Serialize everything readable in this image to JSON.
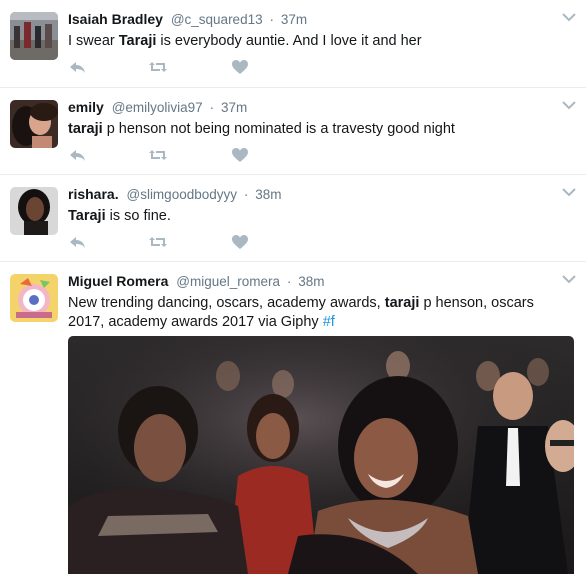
{
  "tweets": [
    {
      "name": "Isaiah Bradley",
      "handle": "@c_squared13",
      "separator": "·",
      "time": "37m",
      "text_parts": [
        "I swear ",
        "Taraji",
        " is everybody auntie. And I love it and her"
      ]
    },
    {
      "name": "emily",
      "handle": "@emilyolivia97",
      "separator": "·",
      "time": "37m",
      "text_parts": [
        "taraji",
        " p henson not being nominated is a travesty good night"
      ]
    },
    {
      "name": "rishara.",
      "handle": "@slimgoodbodyyy",
      "separator": "·",
      "time": "38m",
      "text_parts": [
        "Taraji",
        " is so fine."
      ]
    },
    {
      "name": "Miguel Romera",
      "handle": "@miguel_romera",
      "separator": "·",
      "time": "38m",
      "text_parts": [
        "New trending dancing, oscars, academy awards, ",
        "taraji",
        " p henson, oscars 2017, academy awards 2017 via Giphy ",
        "#f"
      ]
    }
  ],
  "icons": [
    "reply-icon",
    "retweet-icon",
    "like-icon",
    "chevron-down-icon"
  ],
  "colors": {
    "icon": "#aab8c2",
    "link": "#1b95e0",
    "meta": "#657786",
    "divider": "#e6ecf0"
  }
}
